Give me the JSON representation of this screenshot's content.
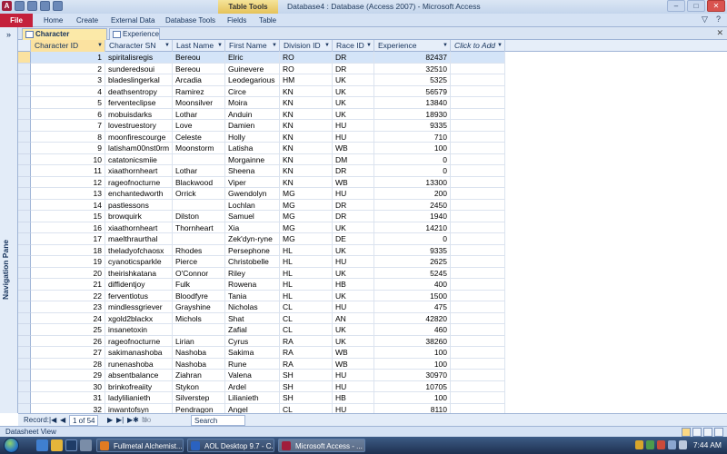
{
  "title_bar": {
    "window_title": "Database4 : Database (Access 2007)  -  Microsoft Access",
    "contextual_tab": "Table Tools",
    "app_icon_letter": "A",
    "controls": {
      "minimize": "–",
      "maximize": "□",
      "close": "✕"
    }
  },
  "ribbon": {
    "tabs": [
      "File",
      "Home",
      "Create",
      "External Data",
      "Database Tools",
      "Fields",
      "Table"
    ],
    "collapse_glyph": "▽",
    "help_glyph": "?"
  },
  "nav_pane": {
    "label": "Navigation Pane",
    "shutter_glyph": "»"
  },
  "doc_tabs": [
    {
      "label": "Character Information"
    },
    {
      "label": "Experience"
    }
  ],
  "doc_close_glyph": "✕",
  "columns": [
    "Character ID",
    "Character SN",
    "Last Name",
    "First Name",
    "Division ID",
    "Race ID",
    "Experience",
    "Click to Add"
  ],
  "rows": [
    {
      "id": "1",
      "sn": "spiritalisregis",
      "last": "Bereou",
      "first": "Elric",
      "div": "RO",
      "race": "DR",
      "exp": "82437"
    },
    {
      "id": "2",
      "sn": "sunderedsoui",
      "last": "Bereou",
      "first": "Guinevere",
      "div": "RO",
      "race": "DR",
      "exp": "32510"
    },
    {
      "id": "3",
      "sn": "bladeslingerkal",
      "last": "Arcadia",
      "first": "Leodegarious",
      "div": "HM",
      "race": "UK",
      "exp": "5325"
    },
    {
      "id": "4",
      "sn": "deathsentropy",
      "last": "Ramirez",
      "first": "Circe",
      "div": "KN",
      "race": "UK",
      "exp": "56579"
    },
    {
      "id": "5",
      "sn": "ferventeclipse",
      "last": "Moonsilver",
      "first": "Moira",
      "div": "KN",
      "race": "UK",
      "exp": "13840"
    },
    {
      "id": "6",
      "sn": "mobuisdarks",
      "last": "Lothar",
      "first": "Anduin",
      "div": "KN",
      "race": "UK",
      "exp": "18930"
    },
    {
      "id": "7",
      "sn": "lovestruestory",
      "last": "Love",
      "first": "Damien",
      "div": "KN",
      "race": "HU",
      "exp": "9335"
    },
    {
      "id": "8",
      "sn": "moonfirescourge",
      "last": "Celeste",
      "first": "Holly",
      "div": "KN",
      "race": "HU",
      "exp": "710"
    },
    {
      "id": "9",
      "sn": "latisham00nst0rm",
      "last": "Moonstorm",
      "first": "Latisha",
      "div": "KN",
      "race": "WB",
      "exp": "100"
    },
    {
      "id": "10",
      "sn": "catatonicsmiie",
      "last": "",
      "first": "Morgainne",
      "div": "KN",
      "race": "DM",
      "exp": "0"
    },
    {
      "id": "11",
      "sn": "xiaathornheart",
      "last": "Lothar",
      "first": "Sheena",
      "div": "KN",
      "race": "DR",
      "exp": "0"
    },
    {
      "id": "12",
      "sn": "rageofnocturne",
      "last": "Blackwood",
      "first": "Viper",
      "div": "KN",
      "race": "WB",
      "exp": "13300"
    },
    {
      "id": "13",
      "sn": "enchantedworth",
      "last": "Orrick",
      "first": "Gwendolyn",
      "div": "MG",
      "race": "HU",
      "exp": "200"
    },
    {
      "id": "14",
      "sn": "pastlessons",
      "last": "",
      "first": "Lochlan",
      "div": "MG",
      "race": "DR",
      "exp": "2450"
    },
    {
      "id": "15",
      "sn": "browquirk",
      "last": "Dilston",
      "first": "Samuel",
      "div": "MG",
      "race": "DR",
      "exp": "1940"
    },
    {
      "id": "16",
      "sn": "xiaathornheart",
      "last": "Thornheart",
      "first": "Xia",
      "div": "MG",
      "race": "UK",
      "exp": "14210"
    },
    {
      "id": "17",
      "sn": "maelthraurthal",
      "last": "",
      "first": "Zek'dyn-ryne",
      "div": "MG",
      "race": "DE",
      "exp": "0"
    },
    {
      "id": "18",
      "sn": "theladyofchaosx",
      "last": "Rhodes",
      "first": "Persephone",
      "div": "HL",
      "race": "UK",
      "exp": "9335"
    },
    {
      "id": "19",
      "sn": "cyanoticsparkle",
      "last": "Pierce",
      "first": "Christobelle",
      "div": "HL",
      "race": "HU",
      "exp": "2625"
    },
    {
      "id": "20",
      "sn": "theirishkatana",
      "last": "O'Connor",
      "first": "Riley",
      "div": "HL",
      "race": "UK",
      "exp": "5245"
    },
    {
      "id": "21",
      "sn": "diffidentjoy",
      "last": "Fulk",
      "first": "Rowena",
      "div": "HL",
      "race": "HB",
      "exp": "400"
    },
    {
      "id": "22",
      "sn": "ferventlotus",
      "last": "Bloodfyre",
      "first": "Tania",
      "div": "HL",
      "race": "UK",
      "exp": "1500"
    },
    {
      "id": "23",
      "sn": "mindlessgriever",
      "last": "Grayshine",
      "first": "Nicholas",
      "div": "CL",
      "race": "HU",
      "exp": "475"
    },
    {
      "id": "24",
      "sn": "xgold2blackx",
      "last": "Michols",
      "first": "Shat",
      "div": "CL",
      "race": "AN",
      "exp": "42820"
    },
    {
      "id": "25",
      "sn": "insanetoxin",
      "last": "",
      "first": "Zafial",
      "div": "CL",
      "race": "UK",
      "exp": "460"
    },
    {
      "id": "26",
      "sn": "rageofnocturne",
      "last": "Lirian",
      "first": "Cyrus",
      "div": "RA",
      "race": "UK",
      "exp": "38260"
    },
    {
      "id": "27",
      "sn": "sakimanashoba",
      "last": "Nashoba",
      "first": "Sakima",
      "div": "RA",
      "race": "WB",
      "exp": "100"
    },
    {
      "id": "28",
      "sn": "runenashoba",
      "last": "Nashoba",
      "first": "Rune",
      "div": "RA",
      "race": "WB",
      "exp": "100"
    },
    {
      "id": "29",
      "sn": "absentbalance",
      "last": "Ziahran",
      "first": "Valena",
      "div": "SH",
      "race": "HU",
      "exp": "30970"
    },
    {
      "id": "30",
      "sn": "brinkofreaiity",
      "last": "Stykon",
      "first": "Ardel",
      "div": "SH",
      "race": "HU",
      "exp": "10705"
    },
    {
      "id": "31",
      "sn": "ladylilianieth",
      "last": "Silverstep",
      "first": "Lilianieth",
      "div": "SH",
      "race": "HB",
      "exp": "100"
    },
    {
      "id": "32",
      "sn": "inwantofsyn",
      "last": "Pendragon",
      "first": "Angel",
      "div": "CL",
      "race": "HU",
      "exp": "8110"
    }
  ],
  "record_nav": {
    "label": "Record:",
    "first": "|◀",
    "prev": "◀",
    "position": "1 of 54",
    "next": "▶",
    "last": "▶|",
    "new": "▶✱",
    "filter": "No Filter",
    "search": "Search"
  },
  "status_bar": {
    "text": "Datasheet View"
  },
  "taskbar": {
    "items": [
      {
        "label": "Fullmetal Alchemist..."
      },
      {
        "label": "AOL Desktop 9.7 - C..."
      },
      {
        "label": "Microsoft Access - ..."
      }
    ],
    "clock": "7:44 AM"
  }
}
